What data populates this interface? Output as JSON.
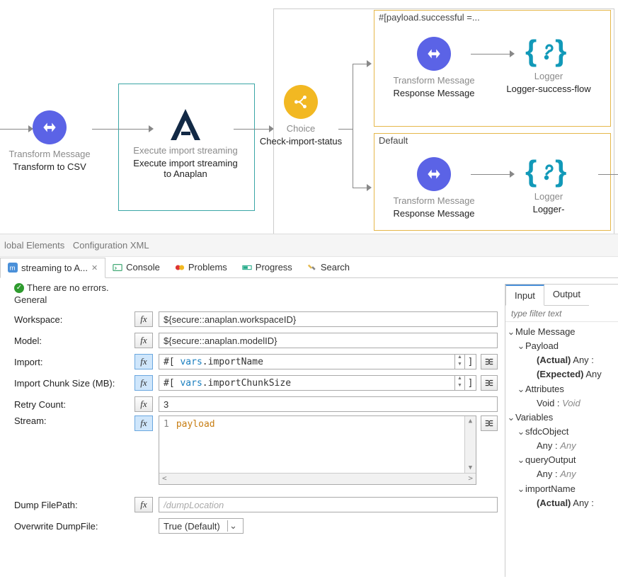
{
  "flow": {
    "transform_csv": {
      "title": "Transform Message",
      "sub": "Transform to CSV"
    },
    "execute_import": {
      "title": "Execute import streaming",
      "sub": "Execute import streaming to Anaplan"
    },
    "choice": {
      "title": "Choice",
      "sub": "Check-import-status"
    },
    "branch1_label": "#[payload.successful =...",
    "branch2_label": "Default",
    "response_msg": {
      "title": "Transform Message",
      "sub": "Response Message"
    },
    "logger_success": {
      "title": "Logger",
      "sub": "Logger-success-flow"
    },
    "logger_fail": {
      "title": "Logger",
      "sub": "Logger-"
    }
  },
  "subtabs": {
    "global": "lobal Elements",
    "config": "Configuration XML"
  },
  "tabs": {
    "active": "streaming to A...",
    "console": "Console",
    "problems": "Problems",
    "progress": "Progress",
    "search": "Search"
  },
  "status": "There are no errors.",
  "section": "General",
  "form": {
    "workspace": {
      "label": "Workspace:",
      "value": "${secure::anaplan.workspaceID}"
    },
    "model": {
      "label": "Model:",
      "value": "${secure::anaplan.modelID}"
    },
    "import_lbl": "Import:",
    "import_kw": "vars",
    "import_rest": ".importName",
    "chunk_lbl": "Import Chunk Size (MB):",
    "chunk_kw": "vars",
    "chunk_rest": ".importChunkSize",
    "retry": {
      "label": "Retry Count:",
      "value": "3"
    },
    "stream": {
      "label": "Stream:",
      "line_no": "1",
      "kw": "payload"
    },
    "dump": {
      "label": "Dump FilePath:",
      "placeholder": "/dumpLocation"
    },
    "overwrite": {
      "label": "Overwrite DumpFile:",
      "value": "True (Default)"
    }
  },
  "rightTabs": {
    "input": "Input",
    "output": "Output"
  },
  "filter_placeholder": "type filter text",
  "tree": {
    "mule": "Mule Message",
    "payload": "Payload",
    "payload_actual": "(Actual)",
    "payload_actual_type": " Any :",
    "payload_expected": "(Expected)",
    "payload_expected_type": " Any",
    "attributes": "Attributes",
    "attributes_type_a": "Void : ",
    "attributes_type_b": "Void",
    "variables": "Variables",
    "sfdc": "sfdcObject",
    "sfdc_type_a": "Any : ",
    "sfdc_type_b": "Any",
    "query": "queryOutput",
    "query_type_a": "Any : ",
    "query_type_b": "Any",
    "importName": "importName",
    "importName_actual": "(Actual)",
    "importName_type": " Any :"
  }
}
